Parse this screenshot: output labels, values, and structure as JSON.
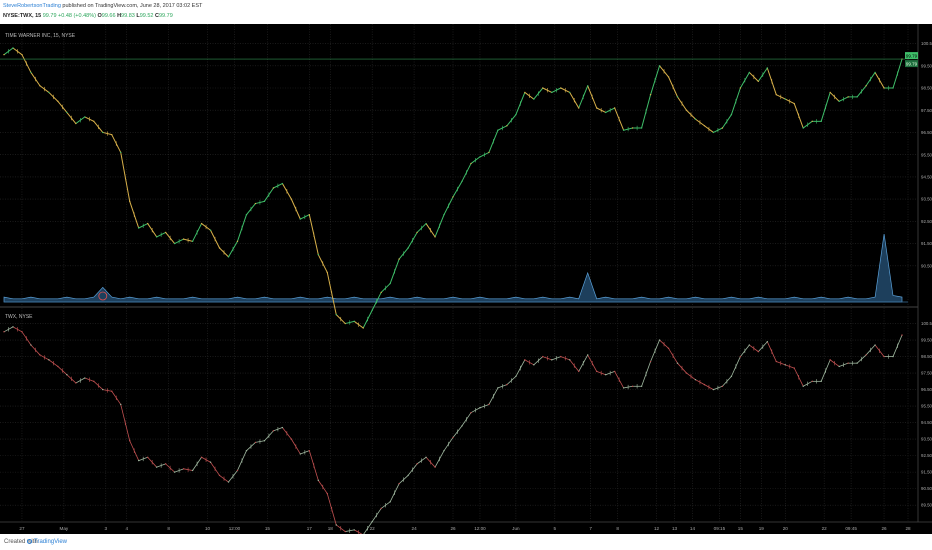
{
  "header": {
    "user": "SteveRobertsonTrading",
    "published": " published on TradingView.com, June 28, 2017 03:02 EST",
    "symbol": "NYSE:TWX, 15",
    "ohlc": {
      "last": "99.79",
      "change": "+0.48 (+0.48%)",
      "open": "99.66",
      "high": "99.83",
      "low": "99.52",
      "close": "99.79"
    }
  },
  "footer": {
    "created": "Created with",
    "brand": "TradingView"
  },
  "chart_data": [
    {
      "type": "line",
      "title": "TIME WARNER INC, 15, NYSE",
      "y_ticks": [
        "100.50",
        "99.50",
        "98.50",
        "97.50",
        "96.50",
        "95.50",
        "94.50",
        "93.50",
        "92.50",
        "91.50",
        "90.50"
      ],
      "last_value_label": "99.79",
      "current_price_label": "99.79",
      "colors": {
        "up": "#3fbf6a",
        "down": "#d9b14a",
        "volume": "#5aa0d8",
        "marker": "#e05050"
      },
      "x": [
        0,
        3,
        6,
        9,
        12,
        15,
        18,
        21,
        24,
        27,
        30,
        33,
        36,
        39,
        42,
        45,
        48,
        51,
        54,
        57,
        60,
        63,
        66,
        69,
        72,
        75,
        78,
        81,
        84,
        87,
        90,
        93,
        96,
        99,
        102,
        105,
        108,
        111,
        114,
        117,
        120,
        123,
        126,
        129,
        132,
        135,
        138,
        141,
        144,
        147,
        150,
        153,
        156,
        159,
        162,
        165,
        168,
        171,
        174,
        177,
        180,
        183,
        186,
        189,
        192,
        195,
        198,
        201,
        204,
        207,
        210,
        213,
        216,
        219,
        222,
        225,
        228,
        231,
        234,
        237,
        240,
        243,
        246,
        249,
        252,
        255,
        258,
        261,
        264,
        267,
        270,
        273,
        276,
        279,
        282,
        285,
        288,
        291,
        294,
        297,
        300
      ],
      "values": [
        100.0,
        100.3,
        100.0,
        99.2,
        98.6,
        98.3,
        97.9,
        97.4,
        96.9,
        97.2,
        97.0,
        96.5,
        96.4,
        95.6,
        93.4,
        92.2,
        92.4,
        91.8,
        92.0,
        91.5,
        91.7,
        91.6,
        92.4,
        92.1,
        91.3,
        90.9,
        91.6,
        92.8,
        93.3,
        93.4,
        94.0,
        94.2,
        93.5,
        92.6,
        92.8,
        91.0,
        90.2,
        88.3,
        87.9,
        88.0,
        87.7,
        88.5,
        89.3,
        89.7,
        90.8,
        91.3,
        92.0,
        92.4,
        91.8,
        92.8,
        93.6,
        94.3,
        95.1,
        95.4,
        95.6,
        96.6,
        96.8,
        97.3,
        98.3,
        98.0,
        98.5,
        98.3,
        98.5,
        98.3,
        97.6,
        98.6,
        97.6,
        97.4,
        97.6,
        96.6,
        96.7,
        96.7,
        98.2,
        99.5,
        99.0,
        98.1,
        97.5,
        97.1,
        96.8,
        96.5,
        96.7,
        97.3,
        98.5,
        99.2,
        98.8,
        99.4,
        98.2,
        98.0,
        97.8,
        96.7,
        97.0,
        97.0,
        98.3,
        97.9,
        98.1,
        98.1,
        98.6,
        99.2,
        98.5,
        98.5,
        99.8
      ],
      "volume": [
        3,
        2,
        2,
        3,
        2,
        2,
        2,
        3,
        2,
        2,
        3,
        9,
        3,
        2,
        3,
        2,
        2,
        3,
        2,
        2,
        2,
        3,
        2,
        2,
        2,
        2,
        3,
        2,
        2,
        3,
        2,
        2,
        2,
        3,
        2,
        2,
        3,
        2,
        2,
        3,
        2,
        2,
        2,
        3,
        2,
        2,
        3,
        2,
        2,
        2,
        3,
        2,
        2,
        3,
        2,
        2,
        2,
        3,
        2,
        2,
        3,
        2,
        2,
        3,
        2,
        18,
        2,
        3,
        2,
        2,
        2,
        3,
        2,
        2,
        3,
        2,
        2,
        3,
        2,
        2,
        2,
        3,
        2,
        2,
        3,
        2,
        2,
        2,
        3,
        2,
        2,
        3,
        2,
        2,
        3,
        2,
        2,
        3,
        42,
        4,
        3
      ],
      "ylim": [
        89.5,
        101.2
      ]
    },
    {
      "type": "line",
      "title": "TWX, NYSE",
      "y_ticks": [
        "100.50",
        "99.50",
        "98.50",
        "97.50",
        "96.50",
        "95.50",
        "94.50",
        "93.50",
        "92.50",
        "91.50",
        "90.50",
        "89.50"
      ],
      "colors": {
        "line": "#a0b8a0",
        "down": "#c05050"
      },
      "x_tick_labels": [
        "27",
        "May",
        "3",
        "4",
        "8",
        "10",
        "12:00",
        "15",
        "17",
        "18",
        "22",
        "24",
        "26",
        "12:00",
        "Jun",
        "5",
        "7",
        "8",
        "12",
        "13",
        "14",
        "09:15",
        "15",
        "19",
        "20",
        "22",
        "09:45",
        "26",
        "28"
      ],
      "x_tick_pos": [
        6,
        20,
        34,
        41,
        55,
        68,
        77,
        88,
        102,
        109,
        123,
        137,
        150,
        159,
        171,
        184,
        196,
        205,
        218,
        224,
        230,
        239,
        246,
        253,
        261,
        274,
        283,
        294,
        302
      ],
      "ylim": [
        88.6,
        101.2
      ]
    }
  ]
}
